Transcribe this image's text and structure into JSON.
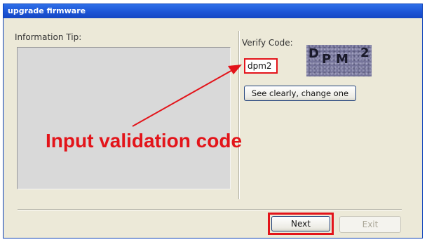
{
  "window": {
    "title": "upgrade firmware"
  },
  "info": {
    "label": "Information Tip:"
  },
  "verify": {
    "label": "Verify Code:",
    "input_value": "dpm2",
    "captcha_chars": [
      "D",
      "P",
      "M",
      "2"
    ],
    "change_label": "See clearly, change one"
  },
  "buttons": {
    "next_label": "Next",
    "exit_label": "Exit"
  },
  "annotation": {
    "text": "Input validation code",
    "color": "#e3141a"
  },
  "colors": {
    "titlebar": "#1c55d6",
    "dialog_bg": "#ece9d8",
    "highlight": "#e3141a",
    "captcha_bg": "#75749a"
  }
}
